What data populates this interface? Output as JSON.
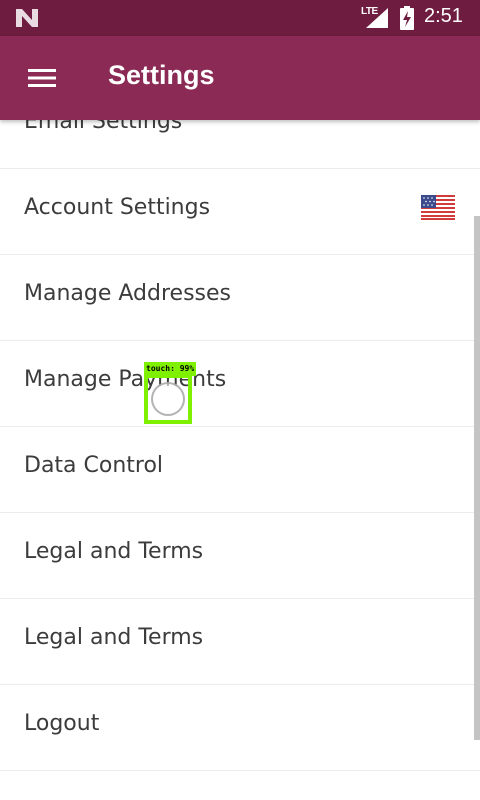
{
  "status_bar": {
    "network_type": "LTE",
    "time": "2:51"
  },
  "app_bar": {
    "title": "Settings",
    "menu_icon": "hamburger-menu-icon",
    "color": "#8b2a54"
  },
  "settings_items": [
    {
      "label": "Email Settings"
    },
    {
      "label": "Account Settings",
      "icon": "us-flag-icon"
    },
    {
      "label": "Manage Addresses"
    },
    {
      "label": "Manage Payments"
    },
    {
      "label": "Data Control"
    },
    {
      "label": "Legal and Terms"
    },
    {
      "label": "Legal and Terms"
    },
    {
      "label": "Logout"
    }
  ],
  "touch_indicator": {
    "label": "touch: 99%"
  }
}
